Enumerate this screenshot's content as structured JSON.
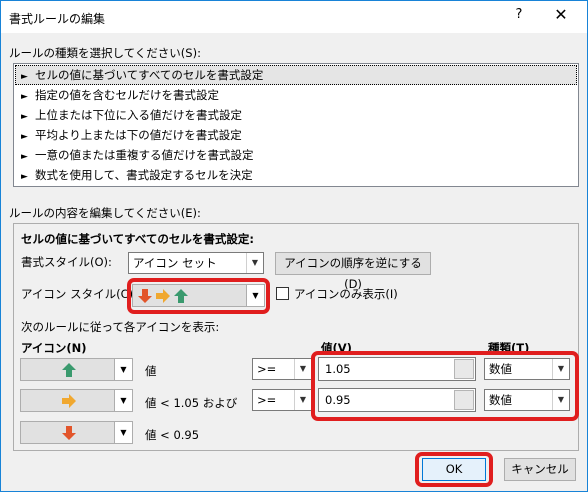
{
  "title": "書式ルールの編集",
  "help_glyph": "?",
  "close_glyph": "✕",
  "rule_type_label": "ルールの種類を選択してください(S):",
  "rule_types": [
    "セルの値に基づいてすべてのセルを書式設定",
    "指定の値を含むセルだけを書式設定",
    "上位または下位に入る値だけを書式設定",
    "平均より上または下の値だけを書式設定",
    "一意の値または重複する値だけを書式設定",
    "数式を使用して、書式設定するセルを決定"
  ],
  "edit_label": "ルールの内容を編集してください(E):",
  "section_heading": "セルの値に基づいてすべてのセルを書式設定:",
  "format_style_label": "書式スタイル(O):",
  "format_style_value": "アイコン セット",
  "reverse_button": "アイコンの順序を逆にする(D)",
  "icon_style_label": "アイコン スタイル(C):",
  "icon_only_label": "アイコンのみ表示(I)",
  "rules_caption": "次のルールに従って各アイコンを表示:",
  "col_icon": "アイコン(N)",
  "col_value": "値(V)",
  "col_type": "種類(T)",
  "rows": [
    {
      "icon": "up-arrow",
      "condition": "値",
      "operator": ">=",
      "value": "1.05",
      "type": "数値"
    },
    {
      "icon": "right-arrow",
      "condition": "値 < 1.05 および",
      "operator": ">=",
      "value": "0.95",
      "type": "数値"
    },
    {
      "icon": "down-arrow",
      "condition": "値 < 0.95"
    }
  ],
  "ok": "OK",
  "cancel": "キャンセル",
  "colors": {
    "up": "#3a9a6e",
    "right": "#f0a830",
    "down": "#e2552b",
    "highlight": "#e01e1e"
  }
}
